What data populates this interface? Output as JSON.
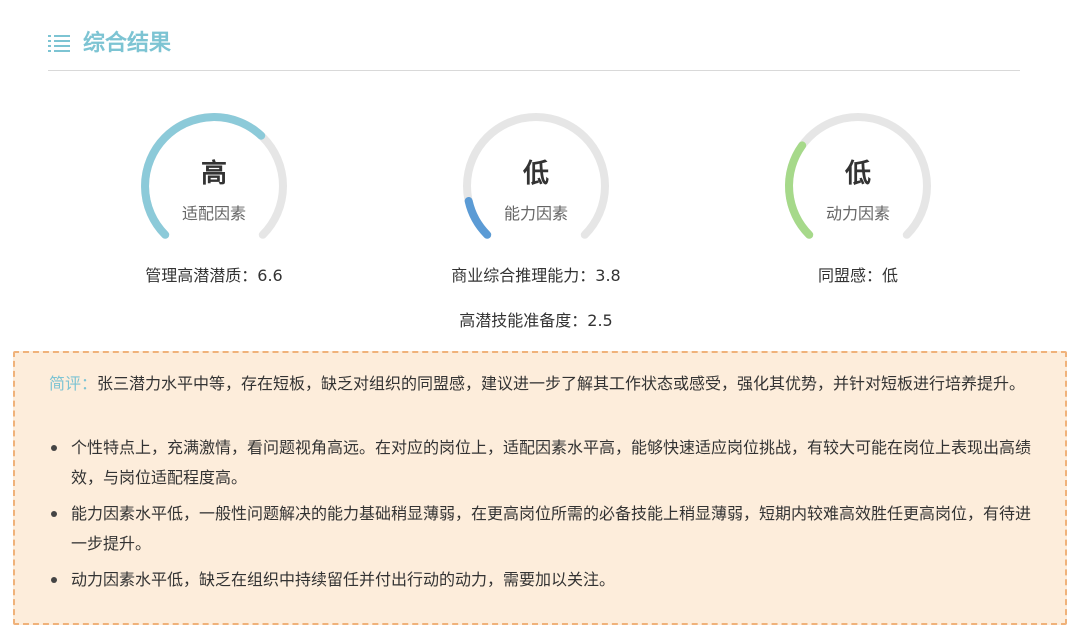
{
  "header": {
    "title": "综合结果",
    "icon": "list-icon"
  },
  "gauges": [
    {
      "level": "高",
      "label": "适配因素",
      "value": 0.66,
      "color": "#8ccad9"
    },
    {
      "level": "低",
      "label": "能力因素",
      "value": 0.12,
      "color": "#5b9bd5"
    },
    {
      "level": "低",
      "label": "动力因素",
      "value": 0.3,
      "color": "#a6d98a"
    }
  ],
  "metrics": {
    "m1": "管理高潜潜质：6.6",
    "m2": "商业综合推理能力：3.8",
    "m3": "高潜技能准备度：2.5",
    "m4": "同盟感：低"
  },
  "panel": {
    "summary_label": "简评：",
    "summary_text": "张三潜力水平中等，存在短板，缺乏对组织的同盟感，建议进一步了解其工作状态或感受，强化其优势，并针对短板进行培养提升。",
    "bullets": [
      "个性特点上，充满激情，看问题视角高远。在对应的岗位上，适配因素水平高，能够快速适应岗位挑战，有较大可能在岗位上表现出高绩效，与岗位适配程度高。",
      "能力因素水平低，一般性问题解决的能力基础稍显薄弱，在更高岗位所需的必备技能上稍显薄弱，短期内较难高效胜任更高岗位，有待进一步提升。",
      "动力因素水平低，缺乏在组织中持续留任并付出行动的动力，需要加以关注。"
    ]
  },
  "colors": {
    "accent": "#7dc4d3",
    "track": "#e6e6e6",
    "panel_bg": "#fdeddb",
    "panel_border": "#f0b27a"
  }
}
